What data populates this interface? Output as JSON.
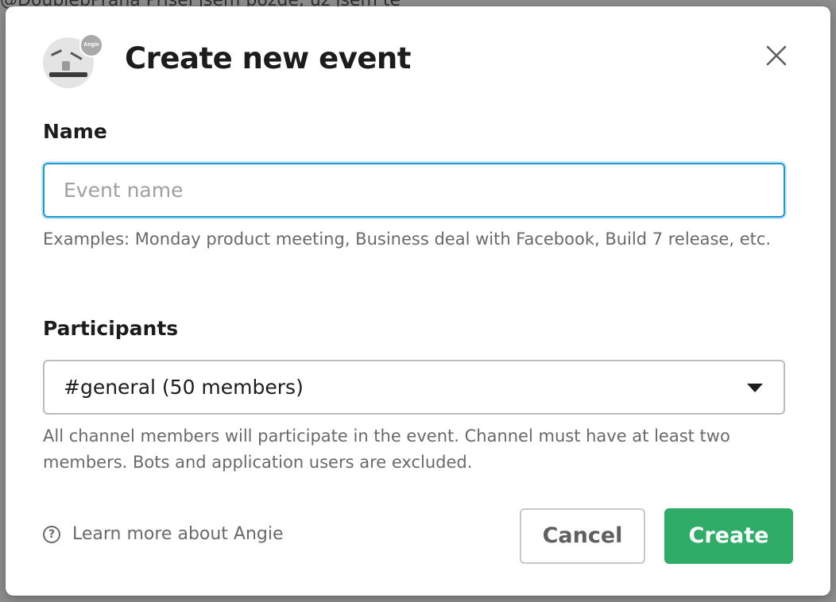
{
  "background": {
    "message_fragment": "@DoublebPraha  Přišel jsem pozdě, už jsem tě"
  },
  "modal": {
    "title": "Create new event",
    "avatar_badge": "Angie",
    "close_icon": "close-icon"
  },
  "form": {
    "name": {
      "label": "Name",
      "placeholder": "Event name",
      "value": "",
      "hint": "Examples: Monday product meeting, Business deal with Facebook, Build 7 release, etc."
    },
    "participants": {
      "label": "Participants",
      "selected": "#general (50 members)",
      "hint": "All channel members will participate in the event. Channel must have at least two members. Bots and application users are excluded."
    }
  },
  "footer": {
    "learn_more": "Learn more about Angie",
    "help_icon": "question-circle-icon",
    "cancel_label": "Cancel",
    "create_label": "Create"
  },
  "colors": {
    "focus_border": "#1d9bd1",
    "primary_button": "#2eac68",
    "text": "#1d1c1d",
    "muted_text": "#696969"
  }
}
